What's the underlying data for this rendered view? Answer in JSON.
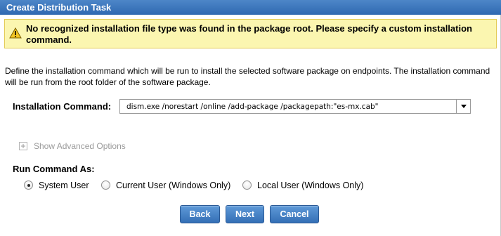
{
  "dialog": {
    "title": "Create Distribution Task"
  },
  "warning": {
    "icon": "warning-triangle-icon",
    "message": "No recognized installation file type was found in the package root. Please specify a custom installation command."
  },
  "description": "Define the installation command which will be run to install the selected software package on endpoints. The installation command will be run from the root folder of the software package.",
  "installation_command": {
    "label": "Installation Command:",
    "value": "dism.exe /norestart /online /add-package /packagepath:\"es-mx.cab\""
  },
  "advanced": {
    "label": "Show Advanced Options"
  },
  "run_command_as": {
    "label": "Run Command As:",
    "options": [
      {
        "label": "System User",
        "selected": true
      },
      {
        "label": "Current User (Windows Only)",
        "selected": false
      },
      {
        "label": "Local User (Windows Only)",
        "selected": false
      }
    ]
  },
  "buttons": {
    "back": "Back",
    "next": "Next",
    "cancel": "Cancel"
  },
  "colors": {
    "title_bar": "#3a74ba",
    "warning_background": "#fbf6b0",
    "button": "#4a85c8"
  }
}
